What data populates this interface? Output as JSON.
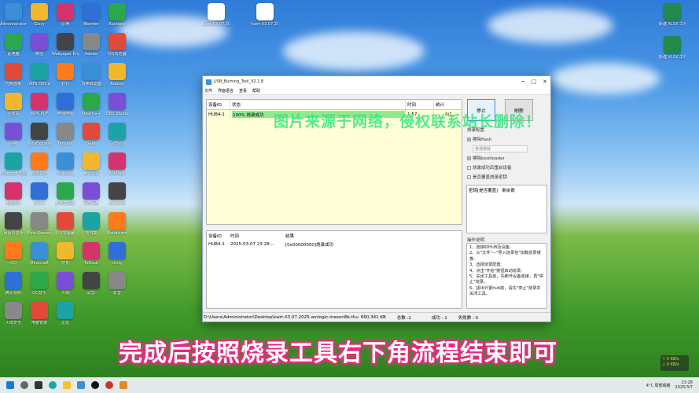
{
  "desktop": {
    "top_files": [
      {
        "label": "kwrt-03.07.2025",
        "icon": "document-icon"
      },
      {
        "label": "kwrt-03.07.2025",
        "icon": "document-icon"
      }
    ],
    "right_files": [
      {
        "label": "新建 XLSX 工作表",
        "icon": "excel-icon"
      },
      {
        "label": "新建 XLSX 工作表",
        "icon": "excel-icon"
      }
    ],
    "icons_col1": [
      "Administrator",
      "此电脑",
      "控制面板",
      "回收站",
      "网络",
      "Microsoft Edge",
      "电脑管家",
      "网易云音乐",
      "QQ",
      "腾讯视频",
      "火绒安全"
    ],
    "icons_col2": [
      "Glary",
      "微信",
      "WPS Office",
      "WPS PDF",
      "NoteExpress",
      "酷狗音乐",
      "Steam",
      "Epic Games",
      "Minecraft",
      "QQ音乐",
      "电脑管家"
    ],
    "icons_col3": [
      "原神",
      "Wallpaper Engine",
      "钉钉",
      "哔哩哔哩",
      "Tencent",
      "Snipaste",
      "雷电模拟器",
      "UU加速器",
      "夸克",
      "火绒",
      "迅雷"
    ],
    "icons_col4": [
      "Blender",
      "Adobe",
      "原神启动器",
      "Steam++",
      "Geek",
      "腾讯会议",
      "百度网盘",
      "向日葵",
      "ToDesk",
      "必剪"
    ],
    "icons_col5": [
      "Rainbow",
      "QQ浏览器",
      "Roblox",
      "OBS Studio",
      "GeForce",
      "AnyDesk",
      "Bandizip",
      "Bandicam",
      "Unity",
      "影音"
    ]
  },
  "window": {
    "title": "USB_Burning_Tool_V2.1.8",
    "menu": [
      "文件",
      "界面语言",
      "查看",
      "帮助"
    ],
    "controls": [
      "─",
      "□",
      "✕"
    ],
    "device_table": {
      "headers": [
        "设备ID",
        "状态",
        "时间",
        "统计"
      ],
      "rows": [
        {
          "id": "HUB4-1",
          "status": "100% 烧录成功",
          "time": "1:57",
          "count": "0/1"
        }
      ]
    },
    "log_table": {
      "headers": [
        "设备ID",
        "时间",
        "结果"
      ],
      "rows": [
        {
          "id": "HUB4-1",
          "time": "2025-03-07 23:28:...",
          "result": "[0x00000000]烧录成功"
        }
      ]
    },
    "buttons": {
      "stop": "停止",
      "refresh": "刷新"
    },
    "config": {
      "title": "烧录配置",
      "erase_flash": "擦除flash",
      "erase_mode": "普通擦除",
      "erase_bootloader": "擦除bootloader",
      "reboot_after": "烧录成功后重启设备",
      "overwrite_key": "是否覆盖烧录密钥"
    },
    "counter": {
      "label": "密钥[是否覆盖]",
      "remaining": "剩余数"
    },
    "steps_title": "操作说明",
    "steps": [
      "1、连接好HUB及设备;",
      "2、从\"文件\"—\"导入烧录包\"加载烧录镜像;",
      "3、选择烧录配置;",
      "4、点击\"开始\"按钮启动烧录;",
      "5、关闭工具前，先断开设备连接，再\"停止\"烧录。",
      "6、拔出外置hub前，请先\"停止\"烧录并关闭工具。"
    ],
    "status": {
      "path": "D:\\Users\\Administrator\\Desktop\\kwrt-03.07.2025-amlogic-meson8b-thu",
      "size": "660,341 KB",
      "total": "总数 :1",
      "success": "成功 : 1",
      "fail": "失败数 : 0"
    }
  },
  "overlay": {
    "watermark": "图片来源于网络，侵权联系站长删除！",
    "caption": "完成后按照烧录工具右下角流程结束即可"
  },
  "network": {
    "up": "↑ 0 KB/s",
    "down": "↓ 0 KB/s"
  },
  "taskbar": {
    "weather": "4°C 局部晴朗",
    "time": "23:28",
    "date": "2025/3/7"
  }
}
